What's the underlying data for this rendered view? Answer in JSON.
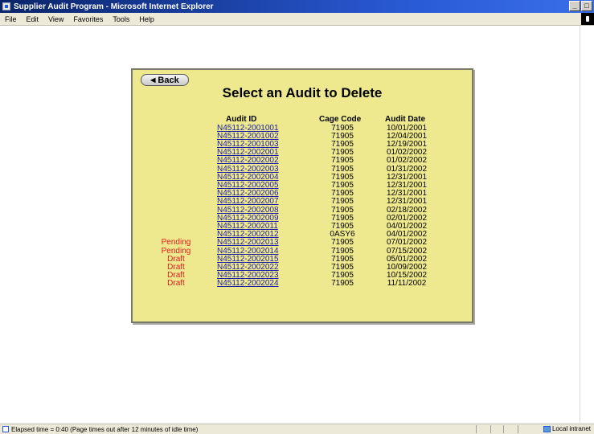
{
  "window": {
    "title": "Supplier Audit Program - Microsoft Internet Explorer",
    "controls": {
      "minimize": "_",
      "restore": "□"
    }
  },
  "menu": [
    "File",
    "Edit",
    "View",
    "Favorites",
    "Tools",
    "Help"
  ],
  "page": {
    "back_label": "Back",
    "back_icon": "left-triangle-icon",
    "title": "Select an Audit to Delete",
    "headers": {
      "audit_id": "Audit ID",
      "cage_code": "Cage Code",
      "audit_date": "Audit Date"
    },
    "rows": [
      {
        "status": "",
        "audit_id": "N45112-2001001",
        "cage_code": "71905",
        "audit_date": "10/01/2001"
      },
      {
        "status": "",
        "audit_id": "N45112-2001002",
        "cage_code": "71905",
        "audit_date": "12/04/2001"
      },
      {
        "status": "",
        "audit_id": "N45112-2001003",
        "cage_code": "71905",
        "audit_date": "12/19/2001"
      },
      {
        "status": "",
        "audit_id": "N45112-2002001",
        "cage_code": "71905",
        "audit_date": "01/02/2002"
      },
      {
        "status": "",
        "audit_id": "N45112-2002002",
        "cage_code": "71905",
        "audit_date": "01/02/2002"
      },
      {
        "status": "",
        "audit_id": "N45112-2002003",
        "cage_code": "71905",
        "audit_date": "01/31/2002"
      },
      {
        "status": "",
        "audit_id": "N45112-2002004",
        "cage_code": "71905",
        "audit_date": "12/31/2001"
      },
      {
        "status": "",
        "audit_id": "N45112-2002005",
        "cage_code": "71905",
        "audit_date": "12/31/2001"
      },
      {
        "status": "",
        "audit_id": "N45112-2002006",
        "cage_code": "71905",
        "audit_date": "12/31/2001"
      },
      {
        "status": "",
        "audit_id": "N45112-2002007",
        "cage_code": "71905",
        "audit_date": "12/31/2001"
      },
      {
        "status": "",
        "audit_id": "N45112-2002008",
        "cage_code": "71905",
        "audit_date": "02/18/2002"
      },
      {
        "status": "",
        "audit_id": "N45112-2002009",
        "cage_code": "71905",
        "audit_date": "02/01/2002"
      },
      {
        "status": "",
        "audit_id": "N45112-2002011",
        "cage_code": "71905",
        "audit_date": "04/01/2002"
      },
      {
        "status": "",
        "audit_id": "N45112-2002012",
        "cage_code": "0ASY6",
        "audit_date": "04/01/2002"
      },
      {
        "status": "Pending",
        "audit_id": "N45112-2002013",
        "cage_code": "71905",
        "audit_date": "07/01/2002"
      },
      {
        "status": "Pending",
        "audit_id": "N45112-2002014",
        "cage_code": "71905",
        "audit_date": "07/15/2002"
      },
      {
        "status": "Draft",
        "audit_id": "N45112-2002015",
        "cage_code": "71905",
        "audit_date": "05/01/2002"
      },
      {
        "status": "Draft",
        "audit_id": "N45112-2002022",
        "cage_code": "71905",
        "audit_date": "10/09/2002"
      },
      {
        "status": "Draft",
        "audit_id": "N45112-2002023",
        "cage_code": "71905",
        "audit_date": "10/15/2002"
      },
      {
        "status": "Draft",
        "audit_id": "N45112-2002024",
        "cage_code": "71905",
        "audit_date": "11/11/2002"
      }
    ]
  },
  "statusbar": {
    "text": "Elapsed time = 0:40 (Page times out after 12 minutes of idle time)",
    "zone": "Local intranet"
  },
  "colors": {
    "panel_bg": "#eee88e",
    "status_red": "#e02020",
    "link_blue": "#1a1aa8"
  }
}
